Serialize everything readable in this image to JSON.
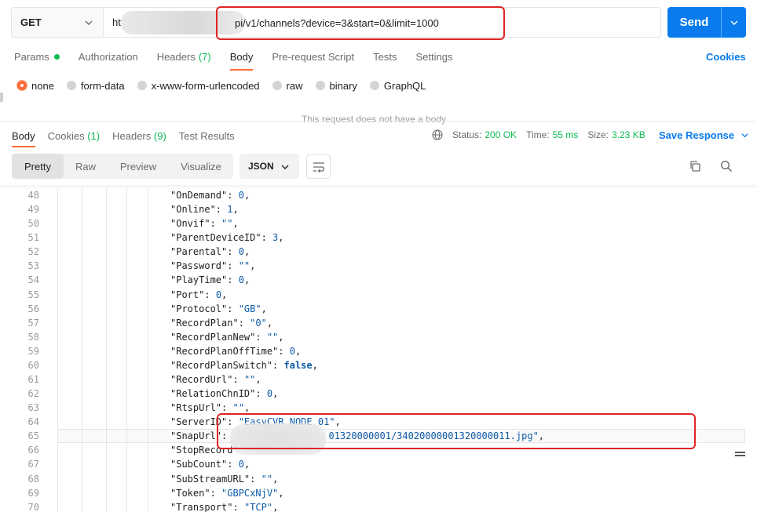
{
  "request": {
    "method": "GET",
    "url_prefix": "htt",
    "url_visible": "pi/v1/channels?device=3&start=0&limit=1000",
    "send_label": "Send"
  },
  "req_tabs": [
    {
      "label": "Params",
      "active": false
    },
    {
      "label": "Authorization",
      "active": false
    },
    {
      "label": "Headers",
      "count": "(7)",
      "active": false
    },
    {
      "label": "Body",
      "active": true
    },
    {
      "label": "Pre-request Script",
      "active": false
    },
    {
      "label": "Tests",
      "active": false
    },
    {
      "label": "Settings",
      "active": false
    }
  ],
  "cookies_link": "Cookies",
  "body_types": [
    "none",
    "form-data",
    "x-www-form-urlencoded",
    "raw",
    "binary",
    "GraphQL"
  ],
  "body_type_selected": "none",
  "no_body_text": "This request does not have a body",
  "resp_tabs": {
    "body": "Body",
    "cookies": "Cookies",
    "cookies_count": "(1)",
    "headers": "Headers",
    "headers_count": "(9)",
    "tests": "Test Results"
  },
  "status": {
    "status_label": "Status:",
    "status_value": "200 OK",
    "time_label": "Time:",
    "time_value": "55 ms",
    "size_label": "Size:",
    "size_value": "3.23 KB",
    "save_response": "Save Response"
  },
  "view_modes": [
    "Pretty",
    "Raw",
    "Preview",
    "Visualize"
  ],
  "view_mode_selected": "Pretty",
  "format": "JSON",
  "colors": {
    "accent": "#ff6c37",
    "send": "#097bed",
    "status_ok": "#0cbb52",
    "annotation": "#e02424"
  },
  "code_lines": [
    {
      "num": "48",
      "key": "\"OnDemand\"",
      "value": "0",
      "vtype": "n"
    },
    {
      "num": "49",
      "key": "\"Online\"",
      "value": "1",
      "vtype": "n"
    },
    {
      "num": "50",
      "key": "\"Onvif\"",
      "value": "\"\"",
      "vtype": "s"
    },
    {
      "num": "51",
      "key": "\"ParentDeviceID\"",
      "value": "3",
      "vtype": "n"
    },
    {
      "num": "52",
      "key": "\"Parental\"",
      "value": "0",
      "vtype": "n"
    },
    {
      "num": "53",
      "key": "\"Password\"",
      "value": "\"\"",
      "vtype": "s"
    },
    {
      "num": "54",
      "key": "\"PlayTime\"",
      "value": "0",
      "vtype": "n"
    },
    {
      "num": "55",
      "key": "\"Port\"",
      "value": "0",
      "vtype": "n"
    },
    {
      "num": "56",
      "key": "\"Protocol\"",
      "value": "\"GB\"",
      "vtype": "s"
    },
    {
      "num": "57",
      "key": "\"RecordPlan\"",
      "value": "\"0\"",
      "vtype": "s"
    },
    {
      "num": "58",
      "key": "\"RecordPlanNew\"",
      "value": "\"\"",
      "vtype": "s"
    },
    {
      "num": "59",
      "key": "\"RecordPlanOffTime\"",
      "value": "0",
      "vtype": "n"
    },
    {
      "num": "60",
      "key": "\"RecordPlanSwitch\"",
      "value": "false",
      "vtype": "b"
    },
    {
      "num": "61",
      "key": "\"RecordUrl\"",
      "value": "\"\"",
      "vtype": "s"
    },
    {
      "num": "62",
      "key": "\"RelationChnID\"",
      "value": "0",
      "vtype": "n"
    },
    {
      "num": "63",
      "key": "\"RtspUrl\"",
      "value": "\"\"",
      "vtype": "s"
    },
    {
      "num": "64",
      "key": "\"ServerID\"",
      "value": "\"EasyCVR_NODE_01\"",
      "vtype": "s"
    },
    {
      "num": "65",
      "key": "\"SnapUrl\"",
      "value": "\"/snap/3402000000132000000101320000001/34020000001320000011.jpg\"",
      "vtype": "s",
      "visible_value": "01320000001/34020000001320000011.jpg\""
    },
    {
      "num": "66",
      "key": "\"StopRecord\"",
      "value": "",
      "vtype": "s",
      "partial": true
    },
    {
      "num": "67",
      "key": "\"SubCount\"",
      "value": "0",
      "vtype": "n"
    },
    {
      "num": "68",
      "key": "\"SubStreamURL\"",
      "value": "\"\"",
      "vtype": "s"
    },
    {
      "num": "69",
      "key": "\"Token\"",
      "value": "\"GBPCxNjV\"",
      "vtype": "s"
    },
    {
      "num": "70",
      "key": "\"Transport\"",
      "value": "\"TCP\"",
      "vtype": "s"
    }
  ]
}
